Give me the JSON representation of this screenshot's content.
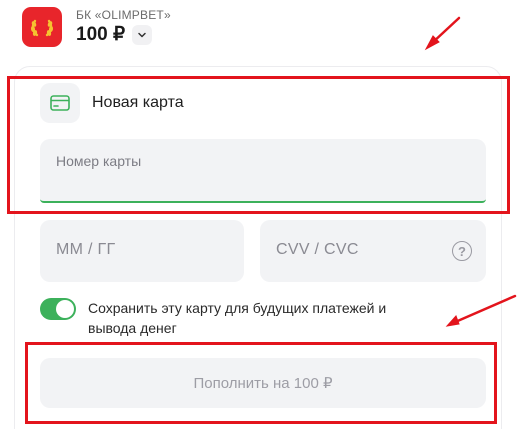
{
  "header": {
    "merchant_name": "БК «OLIMPBET»",
    "amount": "100 ₽",
    "logo_icon": "laurel-wreath-icon",
    "amount_selector_icon": "chevron-down-icon"
  },
  "form": {
    "new_card_label": "Новая карта",
    "card_icon": "credit-card-icon",
    "card_number_placeholder": "Номер карты",
    "expiry_placeholder": "MM / ГГ",
    "cvv_placeholder": "CVV / CVC",
    "cvv_help_icon": "help-icon",
    "cvv_help_glyph": "?",
    "save_card_label": "Сохранить эту карту для будущих платежей и вывода денег",
    "save_card_enabled": true,
    "submit_label": "Пополнить на 100 ₽"
  },
  "annotations": {
    "highlight_color": "#e3141c",
    "arrow_color": "#e3141c"
  },
  "colors": {
    "brand_red": "#e8252b",
    "accent_green": "#3cb15b",
    "field_bg": "#f2f3f5"
  }
}
